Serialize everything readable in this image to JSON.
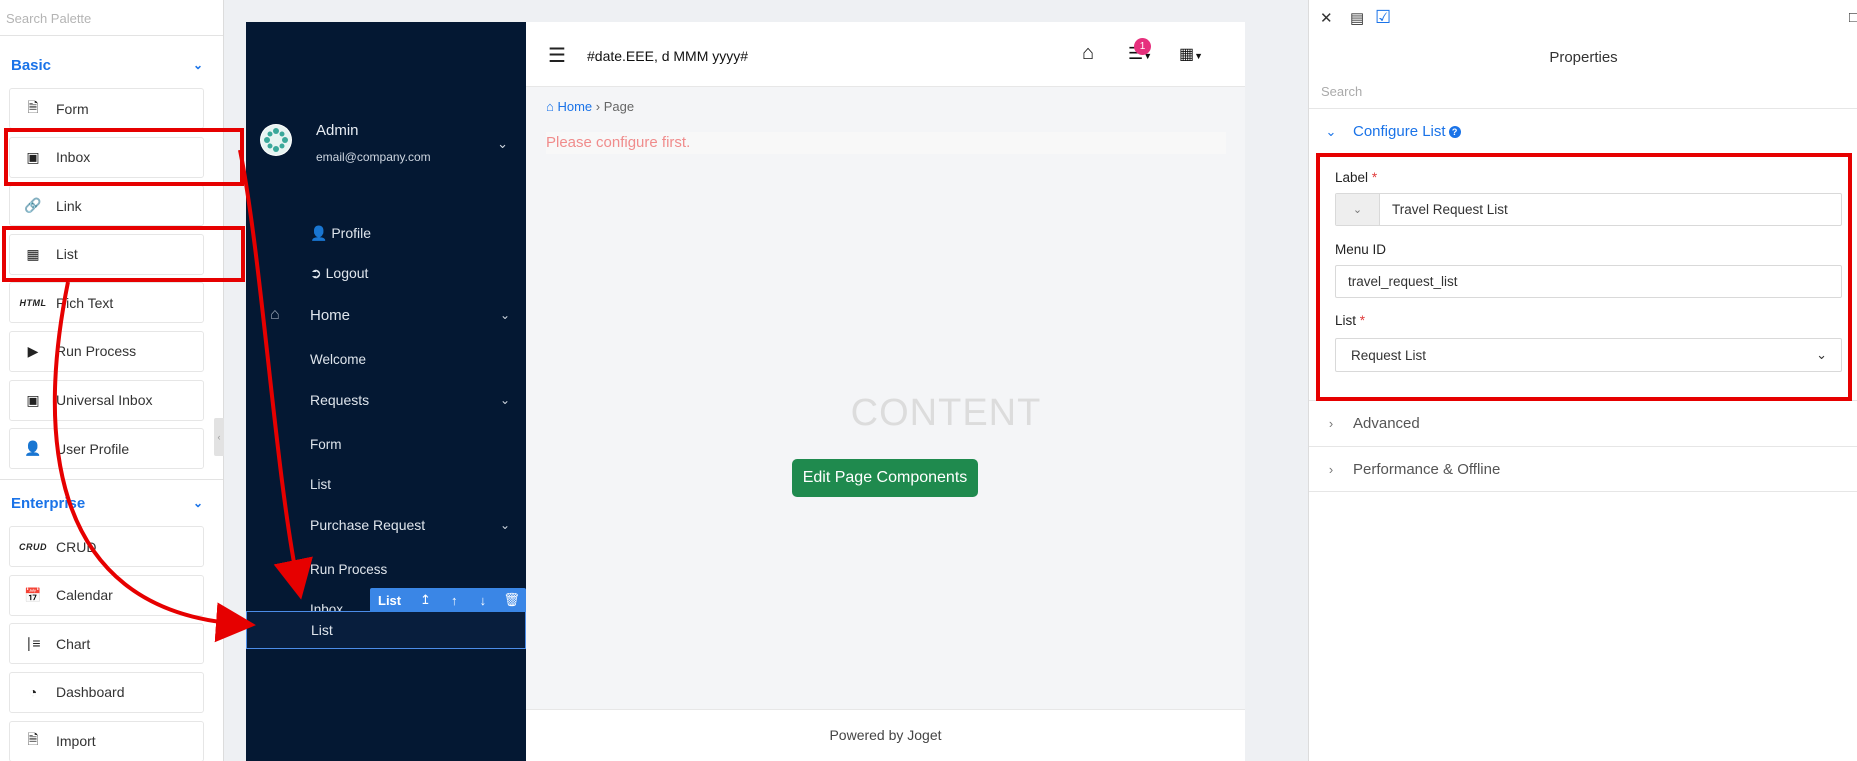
{
  "palette": {
    "search_placeholder": "Search Palette",
    "groups": [
      {
        "title": "Basic",
        "items": [
          {
            "label": "Form",
            "icon": "form-icon"
          },
          {
            "label": "Inbox",
            "icon": "inbox-icon"
          },
          {
            "label": "Link",
            "icon": "link-icon"
          },
          {
            "label": "List",
            "icon": "list-icon"
          },
          {
            "label": "Rich Text",
            "icon": "html-icon",
            "icon_text": "HTML"
          },
          {
            "label": "Run Process",
            "icon": "play-icon"
          },
          {
            "label": "Universal Inbox",
            "icon": "inbox-icon"
          },
          {
            "label": "User Profile",
            "icon": "user-edit-icon"
          }
        ]
      },
      {
        "title": "Enterprise",
        "items": [
          {
            "label": "CRUD",
            "icon": "crud-icon",
            "icon_text": "CRUD"
          },
          {
            "label": "Calendar",
            "icon": "calendar-icon"
          },
          {
            "label": "Chart",
            "icon": "chart-icon"
          },
          {
            "label": "Dashboard",
            "icon": "dashboard-icon"
          },
          {
            "label": "Import",
            "icon": "import-icon"
          }
        ]
      }
    ]
  },
  "sidebar": {
    "user": {
      "name": "Admin",
      "email": "email@company.com"
    },
    "items": [
      {
        "label": "Profile",
        "icon": "user-icon"
      },
      {
        "label": "Logout",
        "icon": "logout-icon"
      },
      {
        "label": "Home",
        "icon": "home-icon"
      },
      {
        "label": "Welcome"
      },
      {
        "label": "Requests"
      },
      {
        "label": "Form"
      },
      {
        "label": "List"
      },
      {
        "label": "Purchase Request"
      },
      {
        "label": "Run Process"
      },
      {
        "label": "Inbox"
      },
      {
        "label": "List"
      }
    ],
    "component_toolbar": {
      "name": "List"
    }
  },
  "header": {
    "title": "#date.EEE, d MMM yyyy#",
    "notification_count": "1"
  },
  "breadcrumb": {
    "home": "Home",
    "current": "Page"
  },
  "main": {
    "notice": "Please configure first.",
    "content_label": "CONTENT",
    "edit_button": "Edit Page Components",
    "footer": "Powered by Joget"
  },
  "properties": {
    "title": "Properties",
    "search_placeholder": "Search",
    "sections": {
      "configure": "Configure List",
      "advanced": "Advanced",
      "performance": "Performance & Offline"
    },
    "fields": {
      "label_label": "Label",
      "label_value": "Travel Request List",
      "menu_id_label": "Menu ID",
      "menu_id_value": "travel_request_list",
      "list_label": "List",
      "list_value": "Request List"
    }
  },
  "colors": {
    "accent": "#1a73e8",
    "sidebar_bg": "#041833",
    "edit_button": "#1f8a4e",
    "annotation": "#e60000"
  }
}
